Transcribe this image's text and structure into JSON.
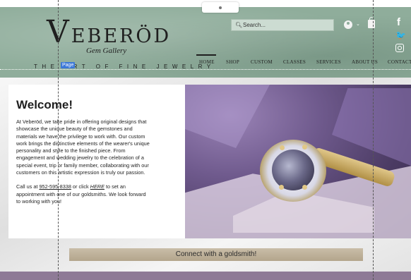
{
  "header": {
    "logo_initial": "V",
    "logo_rest": "EBERÖD",
    "logo_sub": "Gem Gallery",
    "tagline": "THE ART OF FINE JEWELRY",
    "page_tag": "Page",
    "search": {
      "placeholder": "Search..."
    },
    "nav": [
      "HOME",
      "SHOP",
      "CUSTOM",
      "CLASSES",
      "SERVICES",
      "ABOUT US",
      "CONTACT"
    ],
    "social": {
      "facebook": "f",
      "twitter": "🐦"
    }
  },
  "welcome": {
    "title": "Welcome!",
    "body": "At Veberöd, we take pride in offering original designs that showcase the unique beauty of the gemstones and materials we have the privilege to work with.  Our custom work brings the distinctive elements of the wearer's unique personality and style to the finished piece.  From engagement and wedding jewelry to the celebration of a special event, trip or family member, collaborating with our customers on this artistic expression is truly our passion.",
    "call_prefix": "Call us at ",
    "phone": "952-595-8338",
    "call_middle": " or click ",
    "here": "HERE",
    "call_suffix": " to set an appointment with one of our goldsmiths.  We look forward to working with you!"
  },
  "cta": {
    "label": "Connect with a goldsmith!"
  },
  "colors": {
    "header_green": "#8fad9b",
    "cta_tan": "#bfb29a",
    "band_purple": "#8e7a96"
  }
}
